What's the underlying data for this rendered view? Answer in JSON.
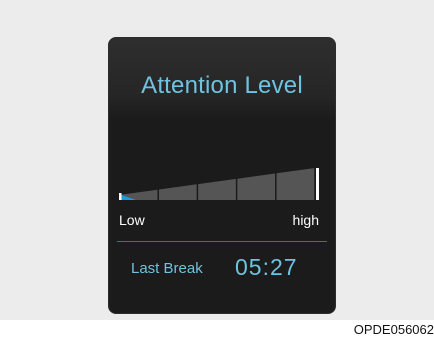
{
  "display": {
    "title": "Attention Level",
    "meter": {
      "level_fraction": 0.1,
      "segments": 5,
      "low_label": "Low",
      "high_label": "high"
    },
    "last_break": {
      "label": "Last Break",
      "time": "05:27"
    }
  },
  "figure_code": "OPDE056062",
  "colors": {
    "screen_bg": "#1b1b1b",
    "accent_blue": "#6fc3e0",
    "meter_fill": "#1e9be0",
    "meter_segment": "#555555"
  }
}
